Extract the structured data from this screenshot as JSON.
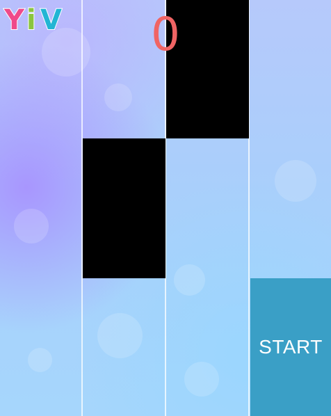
{
  "logo": {
    "text": "YiV"
  },
  "score": "0",
  "start_label": "START",
  "colors": {
    "tile": "#000000",
    "start_tile": "#3a9fc6",
    "score": "#f06464",
    "logo_y": "#ef4a8a",
    "logo_i": "#8bc53f",
    "logo_v": "#22b5d4"
  }
}
